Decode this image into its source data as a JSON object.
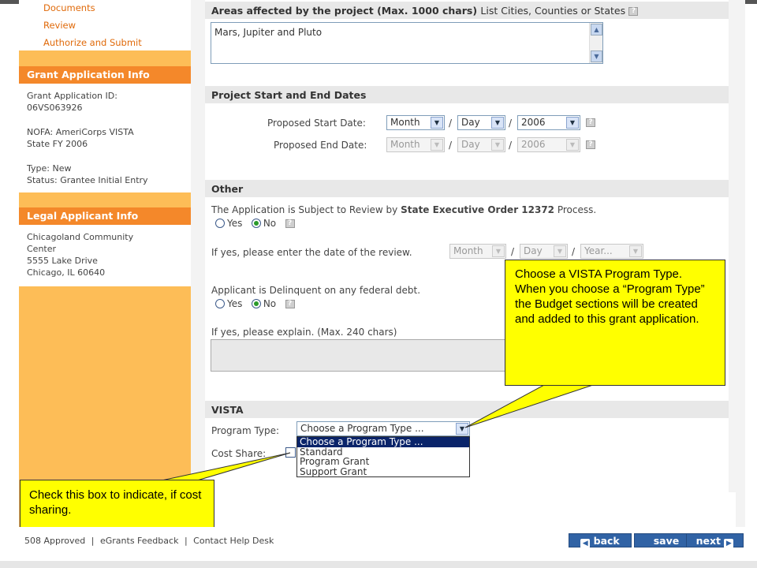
{
  "sidebar": {
    "links": [
      "Documents",
      "Review",
      "Authorize and Submit"
    ],
    "grant_info": {
      "heading": "Grant Application Info",
      "id_label": "Grant Application ID:",
      "id_value": "06VS063926",
      "nofa_line1": "NOFA: AmeriCorps VISTA",
      "nofa_line2": "State FY 2006",
      "type": "Type: New",
      "status": "Status: Grantee Initial Entry"
    },
    "legal": {
      "heading": "Legal Applicant Info",
      "line1": "Chicagoland Community",
      "line2": "Center",
      "line3": "5555 Lake Drive",
      "line4": "Chicago, IL 60640"
    }
  },
  "areas": {
    "heading": "Areas affected by the project (Max. 1000 chars)",
    "heading_extra": "List Cities, Counties or States",
    "value": "Mars, Jupiter and Pluto"
  },
  "dates": {
    "heading": "Project Start and End Dates",
    "start_label": "Proposed Start Date:",
    "end_label": "Proposed End Date:",
    "month": "Month",
    "day": "Day",
    "year": "2006"
  },
  "other": {
    "heading": "Other",
    "review_text_pre": "The Application is Subject to Review by ",
    "review_text_bold": "State Executive Order 12372",
    "review_text_post": " Process.",
    "yes": "Yes",
    "no": "No",
    "review_date_label": "If yes, please enter the date of the review.",
    "review_month": "Month",
    "review_day": "Day",
    "review_year": "Year...",
    "delinquent_text": "Applicant is Delinquent on any federal debt.",
    "explain_label": "If yes, please explain. (Max. 240 chars)"
  },
  "vista": {
    "heading": "VISTA",
    "program_type_label": "Program Type:",
    "program_type_value": "Choose a Program Type ...",
    "options": [
      "Choose a Program Type ...",
      "Standard",
      "Program Grant",
      "Support Grant"
    ],
    "cost_share_label": "Cost Share:"
  },
  "callouts": {
    "program_type": "Choose a VISTA Program Type.  When you choose a “Program Type” the Budget sections will be created and added to this grant application.",
    "cost_share": "Check this box to indicate, if cost sharing."
  },
  "footer": {
    "links": [
      "508 Approved",
      "eGrants Feedback",
      "Contact Help Desk"
    ],
    "separator": "|",
    "back": "back",
    "save": "save",
    "next": "next"
  },
  "colors": {
    "sidebar_bg": "#fdbd57",
    "sidebar_head": "#f4882a",
    "button_blue": "#3163a5",
    "callout_yellow": "#ffff00"
  }
}
